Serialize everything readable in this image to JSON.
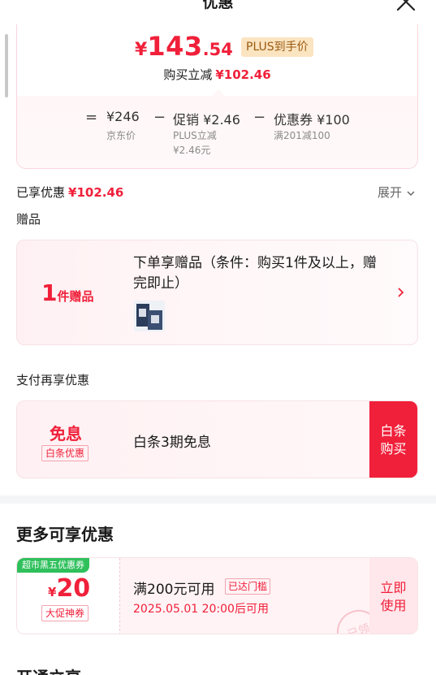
{
  "sheet": {
    "title": "优惠"
  },
  "summary": {
    "price_yen": "¥",
    "price_int": "143",
    "price_dec": ".54",
    "plus_tag": "PLUS到手价",
    "reduce_label": "购买立减",
    "reduce_amount": "¥102.46",
    "calc": {
      "eq": "=",
      "jd_price": "¥246",
      "jd_price_label": "京东价",
      "minus1": "−",
      "promo_label": "促销",
      "promo_value": "¥2.46",
      "promo_sub1": "PLUS立减",
      "promo_sub2": "¥2.46元",
      "minus2": "−",
      "coupon_label": "优惠券",
      "coupon_value": "¥100",
      "coupon_sub": "满201减100"
    }
  },
  "enjoyed": {
    "label": "已享优惠",
    "amount": "¥102.46",
    "expand": "展开"
  },
  "gift": {
    "section": "赠品",
    "count": "1",
    "count_unit": "件赠品",
    "title": "下单享赠品（条件：购买1件及以上，赠完即止）"
  },
  "pay": {
    "section": "支付再享优惠",
    "main": "免息",
    "tag": "白条优惠",
    "text": "白条3期免息",
    "button_line1": "白条",
    "button_line2": "购买"
  },
  "more": {
    "title": "更多可享优惠",
    "coupon": {
      "badge": "超市黑五优惠券",
      "yen": "¥",
      "value": "20",
      "type": "大促神券",
      "condition": "满200元可用",
      "threshold_tag": "已达门槛",
      "time": "2025.05.01 20:00后可用",
      "button_line1": "立即",
      "button_line2": "使用",
      "stamp": "已领"
    }
  },
  "bottom": {
    "title": "开通立享"
  },
  "colors": {
    "accent": "#f0203a",
    "plus_tag_bg": "#fbe4c0",
    "badge_green": "#2fc05c"
  }
}
